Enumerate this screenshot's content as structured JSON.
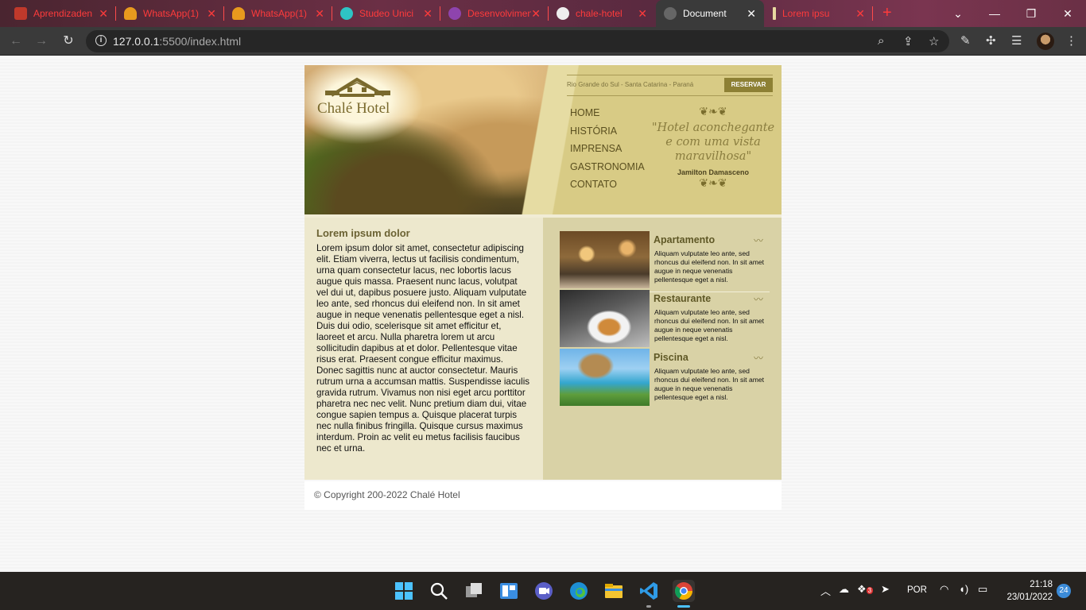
{
  "browser": {
    "tabs": [
      {
        "title": "Aprendizaden",
        "color": "#c0392b"
      },
      {
        "title": "WhatsApp(1)",
        "color": "#e89a1e"
      },
      {
        "title": "WhatsApp(1)",
        "color": "#e89a1e"
      },
      {
        "title": "Studeo Unici",
        "color": "#2ec4c4"
      },
      {
        "title": "Desenvolvimen",
        "color": "#8e44ad"
      },
      {
        "title": "chale-hotel",
        "color": "#eeeeee"
      },
      {
        "title": "Document",
        "color": "#666666"
      },
      {
        "title": "Lorem ipsu",
        "color": "#e8d9a0"
      }
    ],
    "active_tab_title": "Document",
    "url_host": "127.0.0.1",
    "url_rest": ":5500/index.html"
  },
  "site": {
    "logo_text": "Chalé Hotel",
    "location": "Rio Grande do Sul - Santa Catarina - Paraná",
    "reserve_button": "RESERVAR",
    "menu": [
      "HOME",
      "HISTÓRIA",
      "IMPRENSA",
      "GASTRONOMIA",
      "CONTATO"
    ],
    "quote": {
      "text": "\"Hotel aconchegante e com uma vista maravilhosa\"",
      "author": "Jamilton Damasceno"
    },
    "main": {
      "heading": "Lorem ipsum dolor",
      "body": "Lorem ipsum dolor sit amet, consectetur adipiscing elit. Etiam viverra, lectus ut facilisis condimentum, urna quam consectetur lacus, nec lobortis lacus augue quis massa. Praesent nunc lacus, volutpat vel dui ut, dapibus posuere justo. Aliquam vulputate leo ante, sed rhoncus dui eleifend non. In sit amet augue in neque venenatis pellentesque eget a nisl. Duis dui odio, scelerisque sit amet efficitur et, laoreet et arcu. Nulla pharetra lorem ut arcu sollicitudin dapibus at et dolor. Pellentesque vitae risus erat. Praesent congue efficitur maximus. Donec sagittis nunc at auctor consectetur. Mauris rutrum urna a accumsan mattis. Suspendisse iaculis gravida rutrum. Vivamus non nisi eget arcu porttitor pharetra nec nec velit. Nunc pretium diam dui, vitae congue sapien tempus a. Quisque placerat turpis nec nulla finibus fringilla. Quisque cursus maximus interdum. Proin ac velit eu metus facilisis faucibus nec et urna."
    },
    "cards": [
      {
        "title": "Apartamento",
        "text": "Aliquam vulputate leo ante, sed rhoncus dui eleifend non. In sit amet augue in neque venenatis pellentesque eget a nisl."
      },
      {
        "title": "Restaurante",
        "text": "Aliquam vulputate leo ante, sed rhoncus dui eleifend non. In sit amet augue in neque venenatis pellentesque eget a nisl."
      },
      {
        "title": "Piscina",
        "text": "Aliquam vulputate leo ante, sed rhoncus dui eleifend non. In sit amet augue in neque venenatis pellentesque eget a nisl."
      }
    ],
    "footer": "© Copyright 200-2022 Chalé Hotel"
  },
  "taskbar": {
    "language": "POR",
    "time": "21:18",
    "date": "23/01/2022",
    "notifications": "24",
    "tray_badge": "3"
  }
}
